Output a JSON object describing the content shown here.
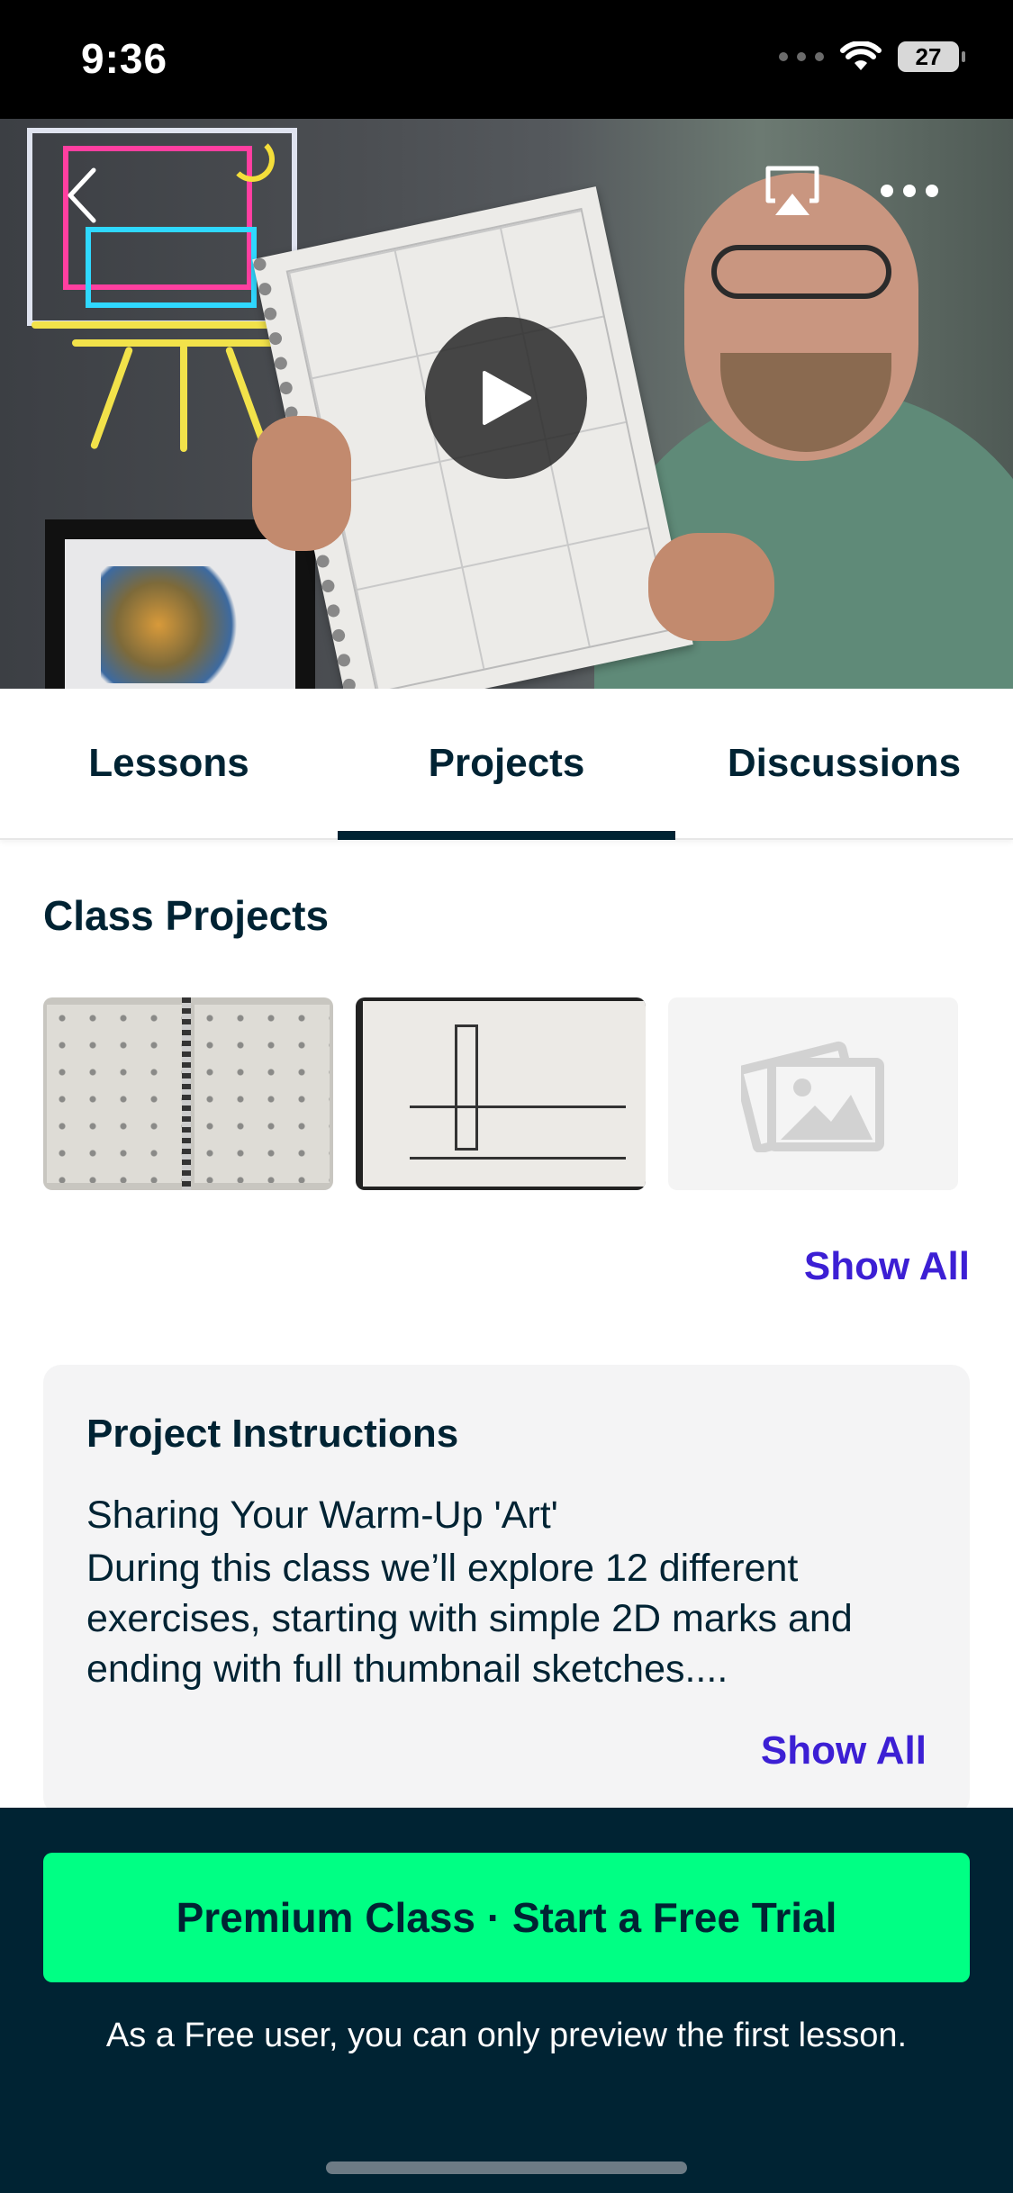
{
  "status_bar": {
    "time": "9:36",
    "battery": "27",
    "icons": [
      "cellular-signal-icon",
      "wifi-icon",
      "battery-icon"
    ]
  },
  "video": {
    "icons": [
      "back-chevron-icon",
      "airplay-icon",
      "more-dots-icon",
      "play-icon"
    ]
  },
  "tabs": [
    {
      "label": "Lessons",
      "active": false
    },
    {
      "label": "Projects",
      "active": true
    },
    {
      "label": "Discussions",
      "active": false
    }
  ],
  "class_projects": {
    "title": "Class Projects",
    "show_all": "Show All",
    "thumbnails": [
      "sketchbook-warmup-thumbnail",
      "village-sketch-thumbnail",
      "placeholder-image-icon"
    ]
  },
  "instructions": {
    "title": "Project Instructions",
    "subtitle": "Sharing Your Warm-Up 'Art'",
    "body": "During this class we’ll explore 12 different exercises, starting with simple 2D marks and ending with full thumbnail sketches....",
    "show_all": "Show All"
  },
  "footer": {
    "cta_label": "Premium Class · Start a Free Trial",
    "note": "As a Free user, you can only preview the first lesson."
  },
  "colors": {
    "primary_dark": "#002333",
    "accent_purple": "#3c1fd4",
    "cta_green": "#00ff84",
    "card_bg": "#f4f4f5"
  }
}
